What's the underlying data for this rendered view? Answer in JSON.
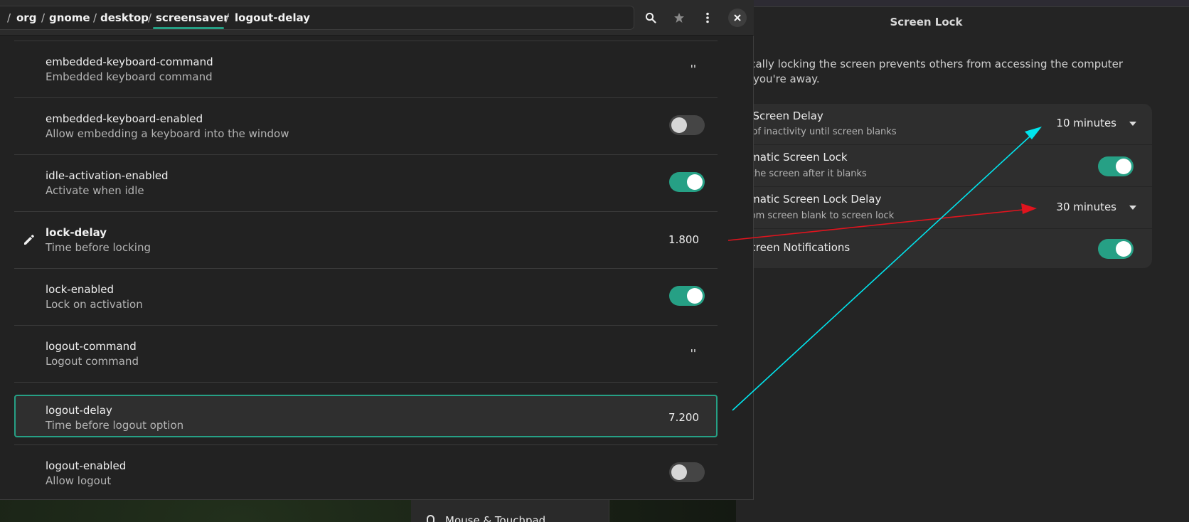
{
  "settings": {
    "title": "Screen Lock",
    "description_line1": "atically locking the screen prevents others from accessing the computer",
    "description_line2": "you're away.",
    "rows": [
      {
        "title": "k Screen Delay",
        "subtitle": "d of inactivity until screen blanks",
        "value": "10 minutes"
      },
      {
        "title": "omatic Screen Lock",
        "subtitle": "s the screen after it blanks",
        "toggle": true
      },
      {
        "title": "omatic Screen Lock Delay",
        "subtitle": "from screen blank to screen lock",
        "value": "30 minutes"
      },
      {
        "title": "Screen Notifications",
        "toggle": true
      }
    ],
    "sidebar_item": "Mouse & Touchpad"
  },
  "dconf": {
    "path": [
      {
        "label": "org"
      },
      {
        "label": "gnome"
      },
      {
        "label": "desktop"
      },
      {
        "label": "screensaver"
      },
      {
        "label": "logout-delay"
      }
    ],
    "separator": "/",
    "keys": [
      {
        "name": "embedded-keyboard-command",
        "desc": "Embedded keyboard command",
        "value": "''"
      },
      {
        "name": "embedded-keyboard-enabled",
        "desc": "Allow embedding a keyboard into the window",
        "toggle": false
      },
      {
        "name": "idle-activation-enabled",
        "desc": "Activate when idle",
        "toggle": true
      },
      {
        "name": "lock-delay",
        "desc": "Time before locking",
        "value": "1.800",
        "modified": true
      },
      {
        "name": "lock-enabled",
        "desc": "Lock on activation",
        "toggle": true
      },
      {
        "name": "logout-command",
        "desc": "Logout command",
        "value": "''"
      },
      {
        "name": "logout-delay",
        "desc": "Time before logout option",
        "value": "7.200",
        "selected": true
      },
      {
        "name": "logout-enabled",
        "desc": "Allow logout",
        "toggle": false
      }
    ]
  },
  "colors": {
    "accent": "#26a085",
    "annotation_red": "#e0141e",
    "annotation_cyan": "#00e5ee"
  },
  "icons": [
    "search-icon",
    "star-icon",
    "menu-icon",
    "close-icon",
    "pencil-icon",
    "dropdown-caret-icon",
    "mouse-icon"
  ]
}
